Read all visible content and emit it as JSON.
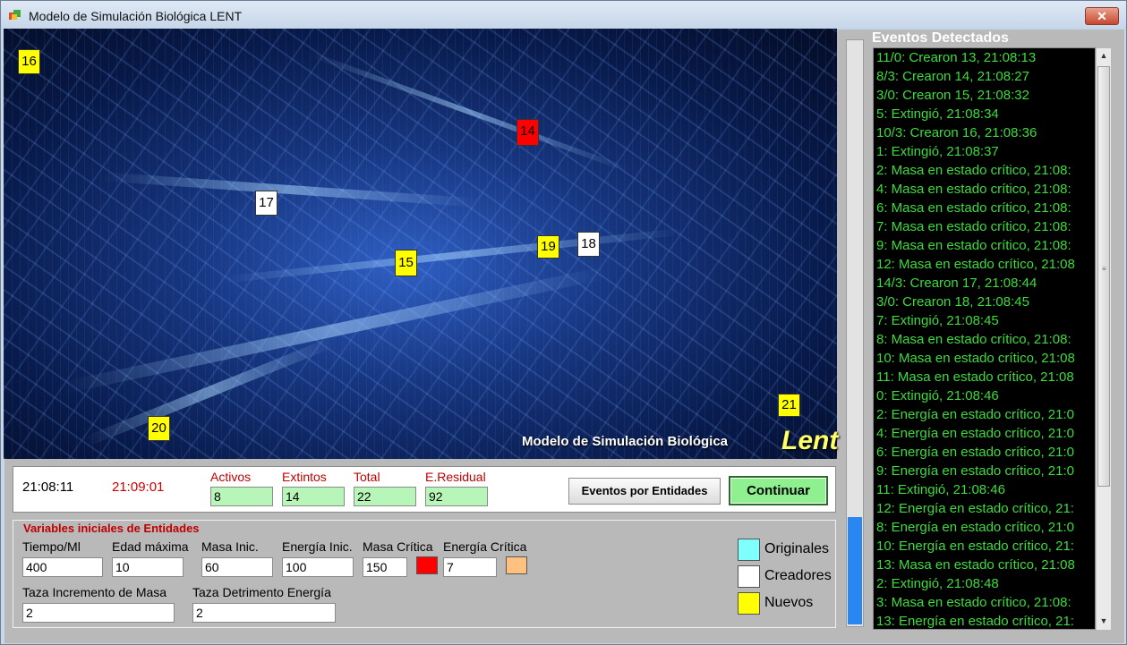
{
  "window": {
    "title": "Modelo de Simulación Biológica LENT",
    "close_label": "✕"
  },
  "scene": {
    "brand_text": "Modelo de Simulación Biológica",
    "brand_lent": "Lent",
    "markers": [
      {
        "label": "16",
        "color": "yellow"
      },
      {
        "label": "14",
        "color": "red"
      },
      {
        "label": "17",
        "color": "white"
      },
      {
        "label": "19",
        "color": "yellow"
      },
      {
        "label": "18",
        "color": "white"
      },
      {
        "label": "15",
        "color": "yellow"
      },
      {
        "label": "21",
        "color": "yellow"
      },
      {
        "label": "20",
        "color": "yellow"
      }
    ]
  },
  "stats": {
    "time_now": "21:08:11",
    "time_end": "21:09:01",
    "activos_label": "Activos",
    "activos_value": "8",
    "extintos_label": "Extintos",
    "extintos_value": "14",
    "total_label": "Total",
    "total_value": "22",
    "residual_label": "E.Residual",
    "residual_value": "92"
  },
  "buttons": {
    "eventos": "Eventos por Entidades",
    "continuar": "Continuar"
  },
  "variables": {
    "title": "Variables iniciales de Entidades",
    "tiempo_label": "Tiempo/Ml",
    "tiempo_value": "400",
    "edad_label": "Edad máxima",
    "edad_value": "10",
    "masa_label": "Masa Inic.",
    "masa_value": "60",
    "energia_label": "Energía Inic.",
    "energia_value": "100",
    "masa_critica_label": "Masa Crítica",
    "masa_critica_value": "150",
    "energia_critica_label": "Energía Crítica",
    "energia_critica_value": "7",
    "incremento_label": "Taza Incremento de Masa",
    "incremento_value": "2",
    "detrimento_label": "Taza Detrimento Energía",
    "detrimento_value": "2"
  },
  "legend": {
    "originales": "Originales",
    "creadores": "Creadores",
    "nuevos": "Nuevos"
  },
  "colors": {
    "originales": "#80ffff",
    "creadores": "#ffffff",
    "nuevos": "#ffff00",
    "masa_critica": "#ff0000",
    "energia_critica": "#ffc080",
    "event_text": "#3cdc3c"
  },
  "events": {
    "title": "Eventos Detectados",
    "items": [
      "11/0: Crearon 13, 21:08:13",
      "8/3: Crearon 14, 21:08:27",
      "3/0: Crearon 15, 21:08:32",
      "5: Extingió, 21:08:34",
      "10/3: Crearon 16, 21:08:36",
      "1: Extingió, 21:08:37",
      "2: Masa en estado crítico, 21:08:",
      "4: Masa en estado crítico, 21:08:",
      "6: Masa en estado crítico, 21:08:",
      "7: Masa en estado crítico, 21:08:",
      "9: Masa en estado crítico, 21:08:",
      "12: Masa en estado crítico, 21:08",
      "14/3: Crearon 17, 21:08:44",
      "3/0: Crearon 18, 21:08:45",
      "7: Extingió, 21:08:45",
      "8: Masa en estado crítico, 21:08:",
      "10: Masa en estado crítico, 21:08",
      "11: Masa en estado crítico, 21:08",
      "0: Extingió, 21:08:46",
      "2: Energía en estado crítico, 21:0",
      "4: Energía en estado crítico, 21:0",
      "6: Energía en estado crítico, 21:0",
      "9: Energía en estado crítico, 21:0",
      "11: Extingió, 21:08:46",
      "12: Energía en estado crítico, 21:",
      "8: Energía en estado crítico, 21:0",
      "10: Energía en estado crítico, 21:",
      "13: Masa en estado crítico, 21:08",
      "2: Extingió, 21:08:48",
      "3: Masa en estado crítico, 21:08:",
      "13: Energía en estado crítico, 21:"
    ]
  }
}
